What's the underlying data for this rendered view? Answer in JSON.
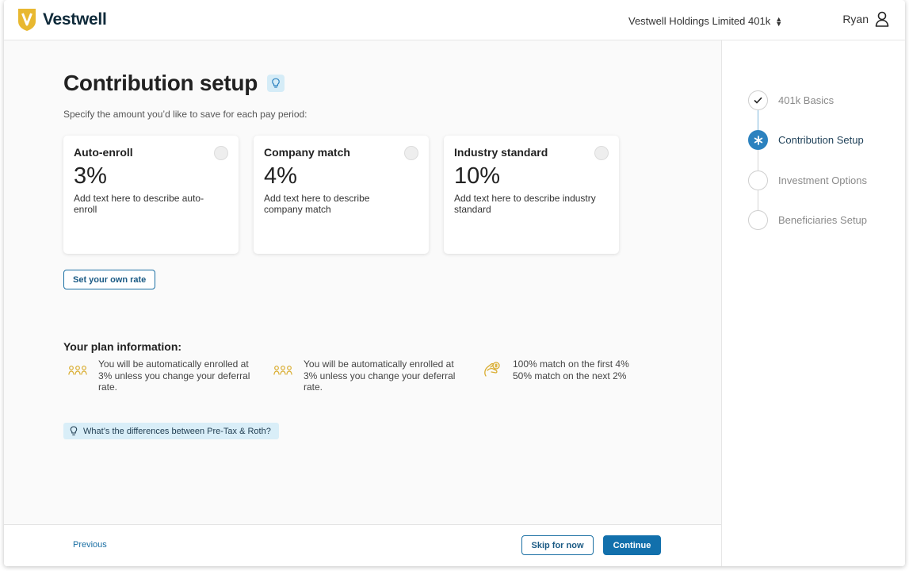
{
  "header": {
    "brand": "Vestwell",
    "plan_name": "Vestwell Holdings Limited 401k",
    "user_name": "Ryan"
  },
  "page": {
    "title": "Contribution setup",
    "subtitle": "Specify the amount you’d like to save for each pay period:"
  },
  "options": [
    {
      "title": "Auto-enroll",
      "percent": "3%",
      "description": "Add text here to describe auto-enroll"
    },
    {
      "title": "Company match",
      "percent": "4%",
      "description": "Add text here to describe company match"
    },
    {
      "title": "Industry standard",
      "percent": "10%",
      "description": "Add text here to describe industry standard"
    }
  ],
  "own_rate_label": "Set your own rate",
  "plan_info": {
    "title": "Your plan information:",
    "items": [
      {
        "icon": "people-icon",
        "text": "You will be automatically enrolled at 3% unless you change your deferral rate."
      },
      {
        "icon": "people-icon",
        "text": "You will be automatically enrolled at 3% unless you change your deferral rate."
      },
      {
        "icon": "hand-coin-icon",
        "text_line1": "100% match on the first 4%",
        "text_line2": "50% match on the next 2%"
      }
    ]
  },
  "tip": "What’s the differences between Pre-Tax & Roth?",
  "footer": {
    "previous": "Previous",
    "skip": "Skip for now",
    "continue": "Continue"
  },
  "steps": [
    {
      "label": "401k Basics",
      "state": "done"
    },
    {
      "label": "Contribution Setup",
      "state": "active"
    },
    {
      "label": "Investment Options",
      "state": "pending"
    },
    {
      "label": "Beneficiaries Setup",
      "state": "pending"
    }
  ],
  "colors": {
    "brand_gold": "#e8b830",
    "primary_blue": "#1270ac",
    "tip_bg": "#d9eef8",
    "icon_gold": "#d9ac2e"
  }
}
